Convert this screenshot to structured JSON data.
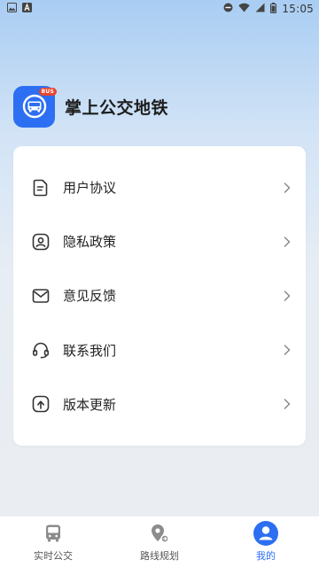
{
  "status_bar": {
    "time": "15:05",
    "icons": [
      "gallery-icon",
      "a-notification-icon",
      "do-not-disturb-icon",
      "wifi-icon",
      "signal-icon",
      "battery-icon"
    ]
  },
  "app": {
    "name": "掌上公交地铁",
    "badge": "BUS",
    "accent_color": "#2c6ff2",
    "badge_color": "#e8452f"
  },
  "menu": {
    "items": [
      {
        "label": "用户协议",
        "icon": "document-icon"
      },
      {
        "label": "隐私政策",
        "icon": "shield-person-icon"
      },
      {
        "label": "意见反馈",
        "icon": "mail-icon"
      },
      {
        "label": "联系我们",
        "icon": "headset-icon"
      },
      {
        "label": "版本更新",
        "icon": "update-icon"
      }
    ]
  },
  "tabbar": {
    "tabs": [
      {
        "label": "实时公交",
        "icon": "bus-icon",
        "active": false
      },
      {
        "label": "路线规划",
        "icon": "route-pin-icon",
        "active": false
      },
      {
        "label": "我的",
        "icon": "profile-icon",
        "active": true
      }
    ]
  }
}
